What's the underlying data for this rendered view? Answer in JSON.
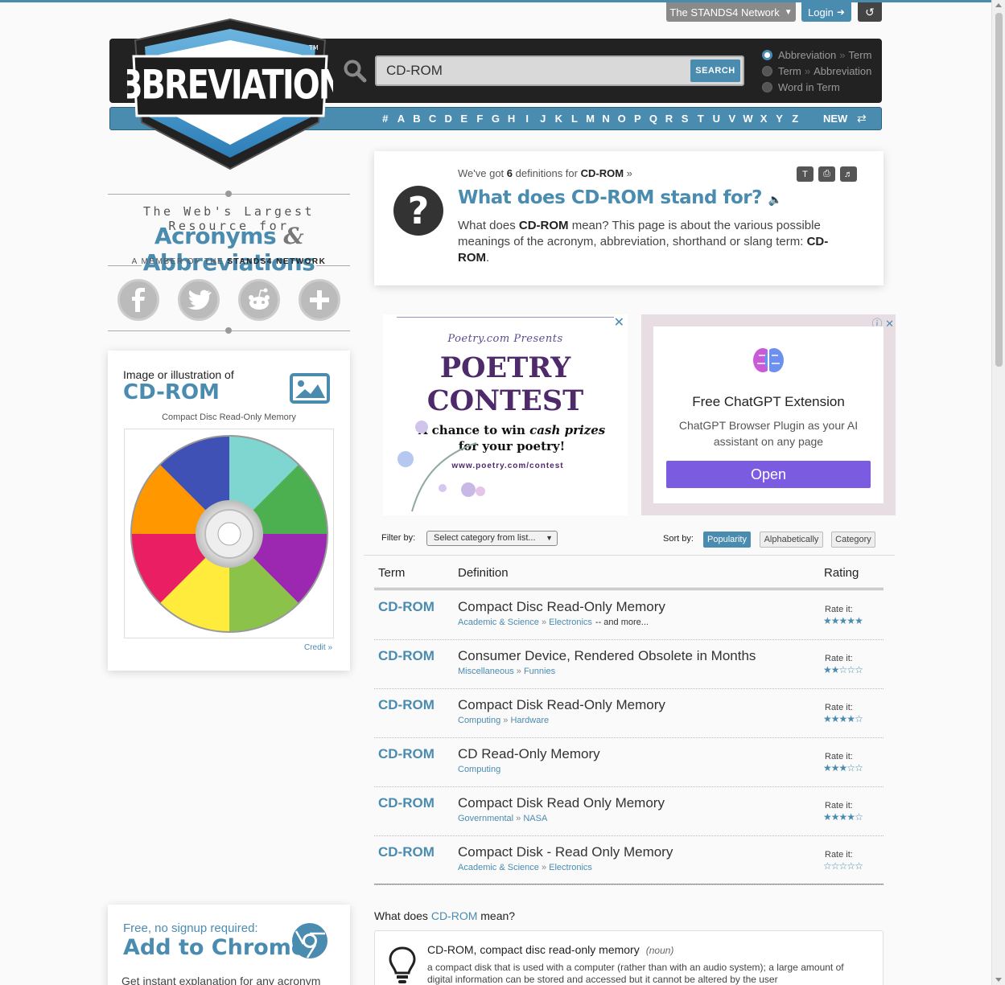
{
  "topbar": {
    "network_label": "The STANDS4 Network",
    "login_label": "Login"
  },
  "search": {
    "value": "CD-ROM",
    "button_label": "SEARCH",
    "options": [
      {
        "a": "Abbreviation",
        "b": "Term",
        "sep": "»",
        "selected": true
      },
      {
        "a": "Term",
        "b": "Abbreviation",
        "sep": "»",
        "selected": false
      },
      {
        "a": "Word in Term",
        "b": "",
        "sep": "",
        "selected": false
      }
    ]
  },
  "alphabet": {
    "letters": [
      "#",
      "A",
      "B",
      "C",
      "D",
      "E",
      "F",
      "G",
      "H",
      "I",
      "J",
      "K",
      "L",
      "M",
      "N",
      "O",
      "P",
      "Q",
      "R",
      "S",
      "T",
      "U",
      "V",
      "W",
      "X",
      "Y",
      "Z"
    ],
    "new_label": "NEW"
  },
  "logo": {
    "text": "ABBREVIATIONS",
    "tm": "TM"
  },
  "tagline": {
    "line1": "The Web's Largest Resource for",
    "line2_a": "Acronyms",
    "line2_amp": "&",
    "line2_b": "Abbreviations",
    "line3_prefix": "A MEMBER OF THE",
    "line3_brand": "STANDS4 NETWORK"
  },
  "social": [
    "facebook-icon",
    "twitter-icon",
    "reddit-icon",
    "plus-icon"
  ],
  "image_card": {
    "label": "Image or illustration of",
    "term": "CD-ROM",
    "caption": "Compact Disc Read-Only Memory",
    "credit": "Credit »"
  },
  "chrome_card": {
    "line1": "Free, no signup required:",
    "line2": "Add to Chrome",
    "line3": "Get instant explanation for any acronym"
  },
  "info": {
    "got_prefix": "We've got",
    "count": "6",
    "got_mid": "definitions for",
    "term": "CD-ROM",
    "got_suffix": "»",
    "title": "What does CD-ROM stand for?",
    "desc_a": "What does",
    "desc_term": "CD-ROM",
    "desc_b": "mean? This page is about the various possible meanings of the acronym, abbreviation, shorthand or slang term:",
    "desc_term2": "CD-ROM",
    "desc_end": "."
  },
  "ad_poetry": {
    "presents": "Poetry.com Presents",
    "word1": "POETRY",
    "word2": "CONTEST",
    "chance_a": "A chance to win",
    "chance_em": "cash prizes",
    "chance_b": "for your poetry!",
    "url": "www.poetry.com/contest"
  },
  "ad_chatgpt": {
    "title": "Free ChatGPT Extension",
    "subtitle": "ChatGPT Browser Plugin as your AI assistant on any page",
    "button": "Open"
  },
  "filter": {
    "filter_label": "Filter by:",
    "select_value": "Select category from list...",
    "sort_label": "Sort by:",
    "sort_options": [
      {
        "label": "Popularity",
        "active": true
      },
      {
        "label": "Alphabetically",
        "active": false
      },
      {
        "label": "Category",
        "active": false
      }
    ]
  },
  "table": {
    "headers": {
      "term": "Term",
      "definition": "Definition",
      "rating": "Rating"
    },
    "rate_label": "Rate it:",
    "rows": [
      {
        "term": "CD-ROM",
        "definition": "Compact Disc Read-Only Memory",
        "cat1": "Academic & Science",
        "cat2": "Electronics",
        "more": "-- and more...",
        "stars": 5
      },
      {
        "term": "CD-ROM",
        "definition": "Consumer Device, Rendered Obsolete in Months",
        "cat1": "Miscellaneous",
        "cat2": "Funnies",
        "more": "",
        "stars": 2
      },
      {
        "term": "CD-ROM",
        "definition": "Compact Disk Read-Only Memory",
        "cat1": "Computing",
        "cat2": "Hardware",
        "more": "",
        "stars": 4
      },
      {
        "term": "CD-ROM",
        "definition": "CD Read-Only Memory",
        "cat1": "Computing",
        "cat2": "",
        "more": "",
        "stars": 3
      },
      {
        "term": "CD-ROM",
        "definition": "Compact Disk Read Only Memory",
        "cat1": "Governmental",
        "cat2": "NASA",
        "more": "",
        "stars": 4
      },
      {
        "term": "CD-ROM",
        "definition": "Compact Disk - Read Only Memory",
        "cat1": "Academic & Science",
        "cat2": "Electronics",
        "more": "",
        "stars": 0
      }
    ]
  },
  "meaning": {
    "heading_a": "What does",
    "heading_term": "CD-ROM",
    "heading_b": "mean?",
    "title": "CD-ROM, compact disc read-only memory",
    "pos": "(noun)",
    "desc": "a compact disk that is used with a computer (rather than with an audio system); a large amount of digital information can be stored and accessed but it cannot be altered by the user"
  },
  "colors": {
    "accent": "#4a8bb0",
    "dark": "#222222",
    "ad_button": "#7b5ce0"
  }
}
